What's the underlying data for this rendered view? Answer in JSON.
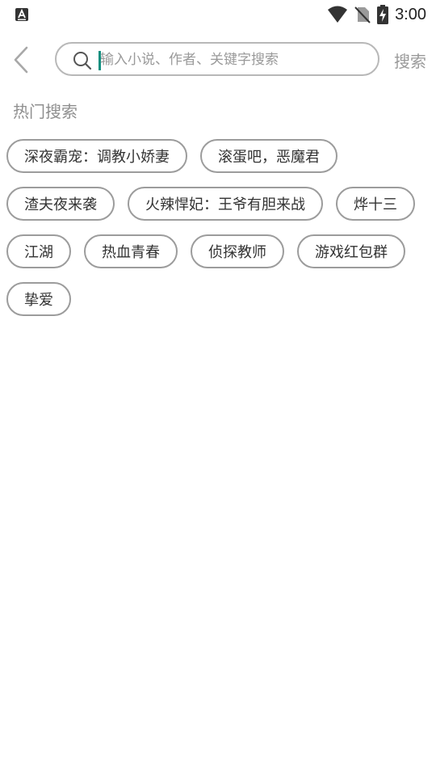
{
  "status_bar": {
    "time": "3:00",
    "icons": [
      "keyboard-a-icon",
      "wifi-icon",
      "no-sim-icon",
      "battery-charging-icon"
    ]
  },
  "header": {
    "back_icon": "chevron-left-icon",
    "search_icon": "search-icon",
    "search_placeholder": "输入小说、作者、关键字搜索",
    "search_value": "",
    "search_button_label": "搜索"
  },
  "hot_search": {
    "title": "热门搜索",
    "rows": [
      [
        "深夜霸宠：调教小娇妻",
        "滚蛋吧，恶魔君"
      ],
      [
        "渣夫夜来袭",
        "火辣悍妃：王爷有胆来战",
        "烨十三"
      ],
      [
        "江湖",
        "热血青春",
        "侦探教师",
        "游戏红包群"
      ],
      [
        "挚爱"
      ]
    ]
  },
  "colors": {
    "caret": "#0f8f7f",
    "border": "#9c9c9c",
    "muted_text": "#9a9a9a"
  }
}
